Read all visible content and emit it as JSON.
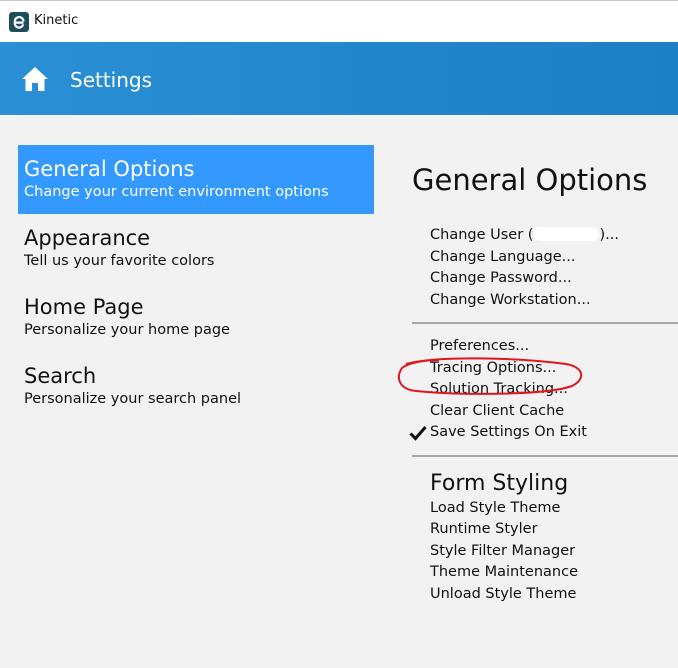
{
  "window": {
    "logo_icon": "kinetic-logo-icon",
    "title": "Kinetic"
  },
  "header": {
    "home_icon": "home-icon",
    "title": "Settings",
    "color": "#2a8fd4"
  },
  "nav": {
    "selected_color": "#3399ff",
    "items": [
      {
        "title": "General Options",
        "description": "Change your current environment options",
        "selected": true
      },
      {
        "title": "Appearance",
        "description": "Tell us your favorite colors",
        "selected": false
      },
      {
        "title": "Home Page",
        "description": "Personalize your home page",
        "selected": false
      },
      {
        "title": "Search",
        "description": "Personalize your search panel",
        "selected": false
      }
    ]
  },
  "panel": {
    "title": "General Options",
    "user_group": {
      "change_user_prefix": "Change User (",
      "change_user_suffix": ")...",
      "change_language": "Change Language...",
      "change_password": "Change Password...",
      "change_workstation": "Change Workstation..."
    },
    "options_group": {
      "preferences": "Preferences...",
      "tracing_options": "Tracing Options...",
      "solution_tracking": "Solution Tracking...",
      "clear_client_cache": "Clear Client Cache",
      "save_settings_on_exit": "Save Settings On Exit",
      "save_settings_checked": true
    },
    "form_styling": {
      "title": "Form Styling",
      "items": [
        "Load Style Theme",
        "Runtime Styler",
        "Style Filter Manager",
        "Theme Maintenance",
        "Unload Style Theme"
      ]
    }
  },
  "annotation": {
    "color": "#e0161d"
  }
}
